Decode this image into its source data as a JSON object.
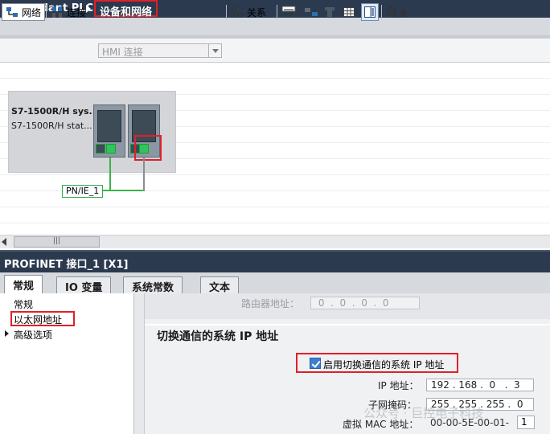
{
  "breadcrumb": {
    "root": "Redundant PLC",
    "current": "设备和网络"
  },
  "toolbar": {
    "network_label": "网络",
    "connection_label": "连接",
    "hmi_connection_value": "HMI 连接",
    "relation_label": "关系"
  },
  "network": {
    "station_title": "S7-1500R/H sys...",
    "station_sub": "S7-1500R/H  stat...",
    "subnet_label": "PN/IE_1"
  },
  "inspector": {
    "title": "PROFINET 接口_1 [X1]",
    "tabs": [
      {
        "label": "常规"
      },
      {
        "label": "IO 变量"
      },
      {
        "label": "系统常数"
      },
      {
        "label": "文本"
      }
    ],
    "nav": [
      {
        "label": "常规"
      },
      {
        "label": "以太网地址"
      },
      {
        "label": "高级选项"
      }
    ],
    "router_label": "路由器地址：",
    "router_value": " 0  .  0  .  0  .  0",
    "section_title": "切换通信的系统 IP 地址",
    "enable_checkbox_label": "启用切换通信的系统 IP 地址",
    "enable_checked": true,
    "ip_label": "IP 地址：",
    "ip_value": "192 . 168 .  0   .  3",
    "subnet_mask_label": "子网掩码：",
    "subnet_mask_value": "255 . 255 . 255 .  0",
    "mac_label": "虚拟 MAC 地址：",
    "mac_value": "00-00-5E-00-01-",
    "mac_suffix": "1"
  },
  "watermark": "公众号 · 巨控电子科技",
  "colors": {
    "header_bg": "#2b3a4e",
    "highlight_red": "#e0202a",
    "port_green": "#2fc55a"
  }
}
